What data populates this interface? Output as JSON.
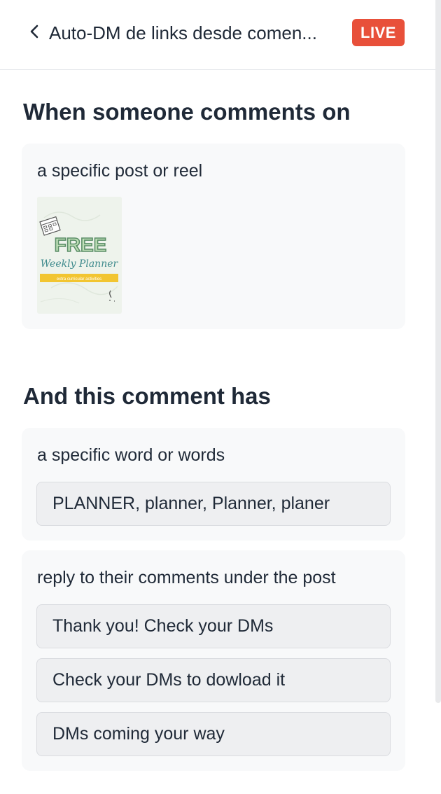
{
  "header": {
    "back_icon": "chevron-left-icon",
    "title": "Auto-DM de links desde comen...",
    "status_badge": "LIVE",
    "status_color": "#e8503a"
  },
  "trigger": {
    "heading": "When someone comments on",
    "target_label": "a specific post or reel",
    "post_thumbnail": {
      "text_big": "FREE",
      "text_script": "Weekly Planner",
      "text_banner": "extra curricular activities"
    }
  },
  "condition": {
    "heading": "And this comment has",
    "keywords_label": "a specific word or words",
    "keywords_value": "PLANNER, planner, Planner, planer"
  },
  "reply": {
    "label": "reply to their comments under the post",
    "options": [
      "Thank you! Check your DMs",
      "Check your DMs to dowload it",
      "DMs coming your way"
    ]
  }
}
